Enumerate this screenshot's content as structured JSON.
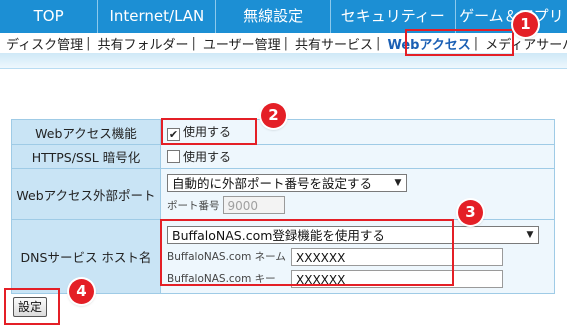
{
  "topnav": {
    "tabs": [
      {
        "label": "TOP"
      },
      {
        "label": "Internet/LAN"
      },
      {
        "label": "無線設定"
      },
      {
        "label": "セキュリティー"
      },
      {
        "label": "ゲーム＆アプリ"
      }
    ]
  },
  "subnav": {
    "items": [
      {
        "label": "ディスク管理"
      },
      {
        "label": "共有フォルダー"
      },
      {
        "label": "ユーザー管理"
      },
      {
        "label": "共有サービス"
      },
      {
        "label": "Webアクセス"
      },
      {
        "label": "メディアサーバー"
      }
    ],
    "active": "Webアクセス"
  },
  "settings": {
    "web_access": {
      "label": "Webアクセス機能",
      "checkbox_label": "使用する",
      "checked": true
    },
    "https_ssl": {
      "label": "HTTPS/SSL 暗号化",
      "checkbox_label": "使用する",
      "checked": false
    },
    "external_port": {
      "label": "Webアクセス外部ポート",
      "select_value": "自動的に外部ポート番号を設定する",
      "port_label": "ポート番号",
      "port_value": "9000"
    },
    "dns": {
      "label": "DNSサービス ホスト名",
      "select_value": "BuffaloNAS.com登録機能を使用する",
      "name_label": "BuffaloNAS.com ネーム",
      "name_value": "XXXXXX",
      "key_label": "BuffaloNAS.com キー",
      "key_value": "XXXXXX"
    }
  },
  "submit_button": {
    "label": "設定"
  },
  "annotations": {
    "color": "#e41f26",
    "badges": [
      "1",
      "2",
      "3",
      "4"
    ]
  }
}
